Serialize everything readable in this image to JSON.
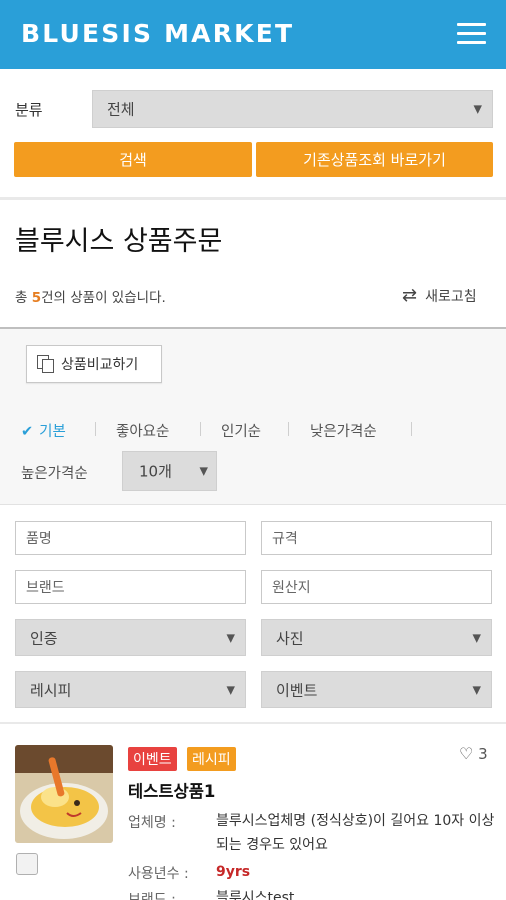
{
  "header": {
    "logo": "BLUESIS MARKET",
    "menu_icon": "hamburger-menu-icon"
  },
  "filter": {
    "category_label": "분류",
    "category_value": "전체",
    "search_button": "검색",
    "existing_button": "기존상품조회 바로가기"
  },
  "page": {
    "title": "블루시스 상품주문",
    "count_prefix": "총 ",
    "count": "5",
    "count_suffix": "건의 상품이 있습니다.",
    "refresh": "새로고침"
  },
  "toolbar": {
    "compare": "상품비교하기",
    "sort_options": [
      "기본",
      "좋아요순",
      "인기순",
      "낮은가격순",
      "높은가격순"
    ],
    "active_sort": "기본",
    "page_size": "10개"
  },
  "search_fields": {
    "name_placeholder": "품명",
    "spec_placeholder": "규격",
    "brand_placeholder": "브랜드",
    "origin_placeholder": "원산지",
    "cert": "인증",
    "photo": "사진",
    "recipe": "레시피",
    "event": "이벤트"
  },
  "products": [
    {
      "badges": [
        {
          "label": "이벤트",
          "color": "#e8423f"
        },
        {
          "label": "레시피",
          "color": "#f39c1f"
        }
      ],
      "likes": "3",
      "name": "테스트상품1",
      "fields": [
        {
          "label": "업체명 :",
          "value": "블루시스업체명 (정식상호)이 길어요 10자 이상 되는 경우도 있어요"
        },
        {
          "label": "사용년수 :",
          "value": "9yrs"
        },
        {
          "label": "브랜드 :",
          "value": "블루시스test"
        }
      ]
    }
  ],
  "colors": {
    "primary": "#2a9fd8",
    "accent": "#f39c1f",
    "event_badge": "#e8423f",
    "years_text": "#c62828"
  }
}
